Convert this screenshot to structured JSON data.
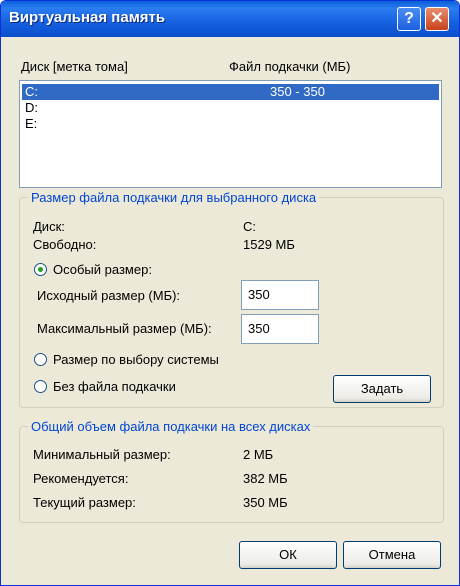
{
  "window": {
    "title": "Виртуальная память",
    "help_glyph": "?",
    "close_glyph": "✕"
  },
  "drives": {
    "col_disk": "Диск [метка тома]",
    "col_paging": "Файл подкачки (МБ)",
    "items": [
      {
        "label": "C:",
        "size": "350 - 350",
        "selected": true
      },
      {
        "label": "D:",
        "size": ""
      },
      {
        "label": "E:",
        "size": ""
      }
    ]
  },
  "selected_drive": {
    "legend": "Размер файла подкачки для выбранного диска",
    "disk_label": "Диск:",
    "disk_value": "C:",
    "free_label": "Свободно:",
    "free_value": "1529 МБ",
    "custom_label": "Особый размер:",
    "initial_label": "Исходный размер (МБ):",
    "initial_value": "350",
    "max_label": "Максимальный размер (МБ):",
    "max_value": "350",
    "system_label": "Размер по выбору системы",
    "none_label": "Без файла подкачки",
    "set_button": "Задать"
  },
  "totals": {
    "legend": "Общий объем файла подкачки на всех дисках",
    "min_label": "Минимальный размер:",
    "min_value": "2 МБ",
    "rec_label": "Рекомендуется:",
    "rec_value": "382 МБ",
    "cur_label": "Текущий размер:",
    "cur_value": "350 МБ"
  },
  "buttons": {
    "ok": "ОК",
    "cancel": "Отмена"
  },
  "colors": {
    "title_bar": "#0a5fd8",
    "selection": "#316ac5",
    "group_legend": "#0046d5"
  }
}
